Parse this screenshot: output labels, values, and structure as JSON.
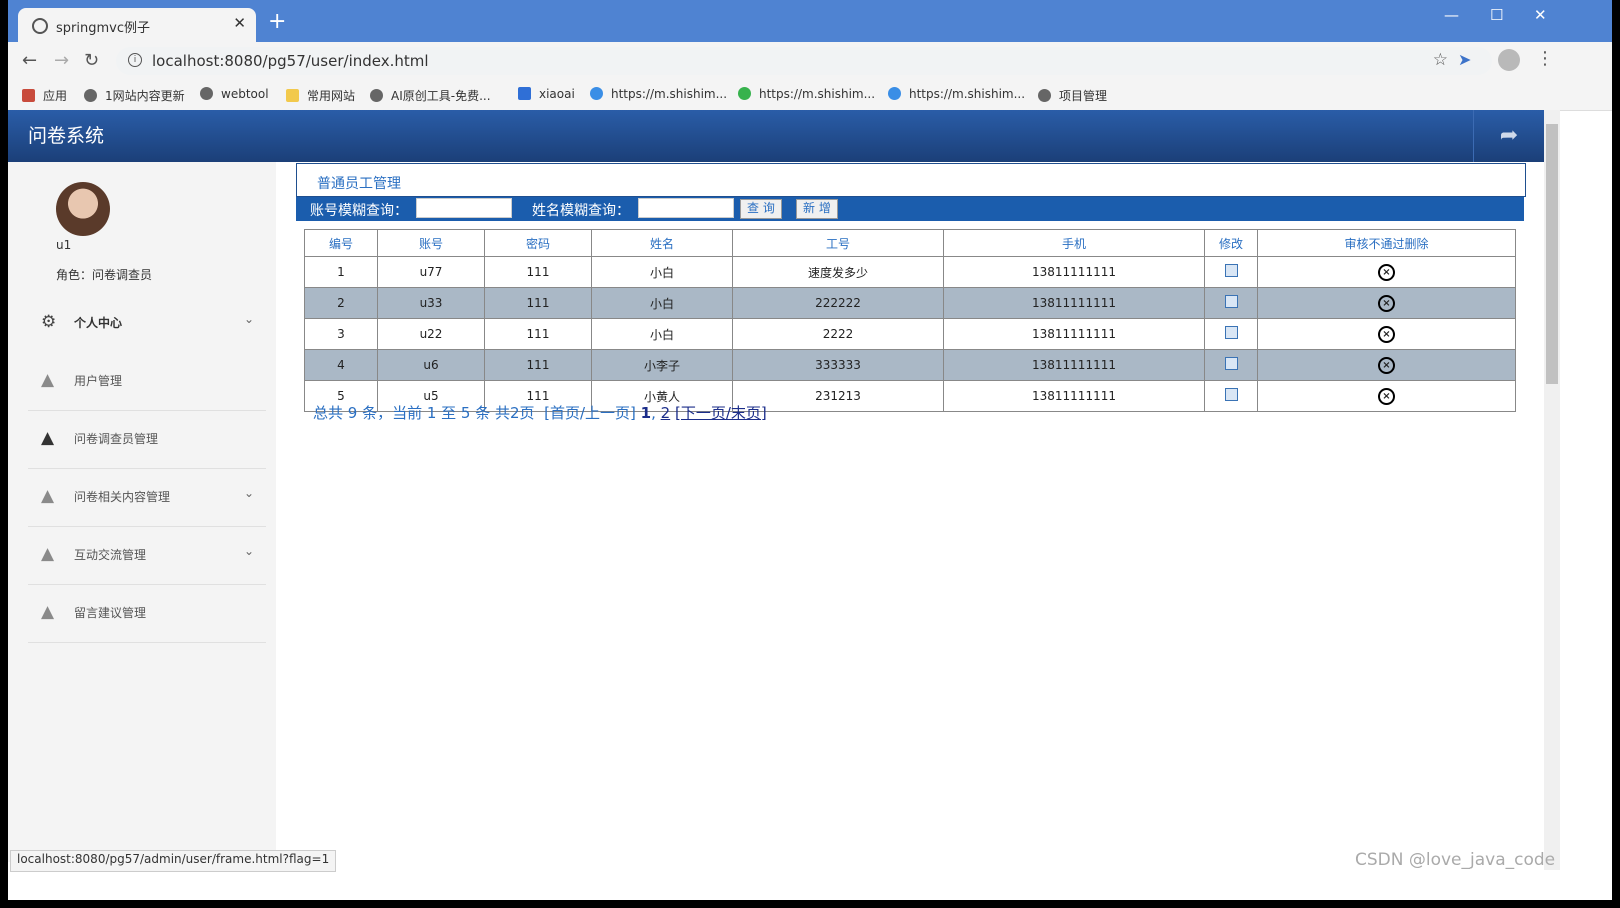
{
  "browser": {
    "tab_title": "springmvc例子",
    "url": "localhost:8080/pg57/user/index.html",
    "bookmarks": [
      "应用",
      "1网站内容更新",
      "webtool",
      "常用网站",
      "AI原创工具-免费...",
      "xiaoai",
      "https://m.shishim...",
      "https://m.shishim...",
      "https://m.shishim...",
      "项目管理"
    ],
    "status_url": "localhost:8080/pg57/admin/user/frame.html?flag=1"
  },
  "app": {
    "title": "问卷系统"
  },
  "sidebar": {
    "username": "u1",
    "role": "角色：问卷调查员",
    "items": [
      {
        "label": "个人中心",
        "icon": "gear-icon",
        "expandable": true
      },
      {
        "label": "用户管理",
        "icon": "users-icon",
        "expandable": false
      },
      {
        "label": "问卷调查员管理",
        "icon": "users-icon",
        "expandable": false
      },
      {
        "label": "问卷相关内容管理",
        "icon": "users-icon",
        "expandable": true
      },
      {
        "label": "互动交流管理",
        "icon": "users-icon",
        "expandable": true
      },
      {
        "label": "留言建议管理",
        "icon": "users-icon",
        "expandable": false
      }
    ]
  },
  "main": {
    "panel_title": "普通员工管理",
    "search": {
      "account_label": "账号模糊查询：",
      "name_label": "姓名模糊查询：",
      "query_button": "查 询",
      "add_button": "新 增"
    },
    "table": {
      "headers": [
        "编号",
        "账号",
        "密码",
        "姓名",
        "工号",
        "手机",
        "修改",
        "审核不通过删除"
      ],
      "rows": [
        [
          "1",
          "u77",
          "111",
          "小白",
          "速度发多少",
          "13811111111"
        ],
        [
          "2",
          "u33",
          "111",
          "小白",
          "222222",
          "13811111111"
        ],
        [
          "3",
          "u22",
          "111",
          "小白",
          "2222",
          "13811111111"
        ],
        [
          "4",
          "u6",
          "111",
          "小李子",
          "333333",
          "13811111111"
        ],
        [
          "5",
          "u5",
          "111",
          "小黄人",
          "231213",
          "13811111111"
        ]
      ]
    },
    "pager": {
      "summary": "总共 9 条，当前 1 至 5 条 共2页",
      "first_prev": "[首页/上一页]",
      "page1": "1",
      "page2": "2",
      "next_last": "[下一页/末页]"
    }
  },
  "watermark": "CSDN @love_java_code"
}
